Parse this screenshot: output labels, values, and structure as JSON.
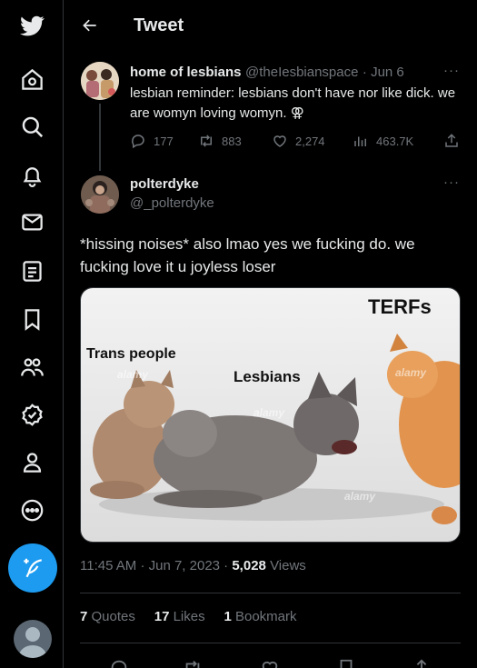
{
  "header": {
    "title": "Tweet"
  },
  "original_tweet": {
    "display_name": "home of lesbians",
    "handle": "@theIesbianspace",
    "date": "· Jun 6",
    "text": "lesbian reminder: lesbians don't have nor like dick. we are womyn loving womyn. ⚢",
    "replies": "177",
    "retweets": "883",
    "likes": "2,274",
    "views": "463.7K",
    "more": "···"
  },
  "reply_tweet": {
    "display_name": "polterdyke",
    "handle": "@_polterdyke",
    "more": "···",
    "text": "*hissing noises* also lmao yes we fucking do. we fucking love it u joyless loser",
    "image": {
      "labels": {
        "left": "Trans people",
        "middle": "Lesbians",
        "right": "TERFs"
      },
      "watermark": "alamy"
    },
    "time": "11:45 AM",
    "date": "· Jun 7, 2023 ·",
    "views_count": "5,028",
    "views_label": "Views",
    "quotes_count": "7",
    "quotes_label": "Quotes",
    "likes_count": "17",
    "likes_label": "Likes",
    "bookmarks_count": "1",
    "bookmarks_label": "Bookmark"
  },
  "colors": {
    "accent": "#1d9bf0",
    "muted": "#71767b",
    "text": "#e7e9ea",
    "border": "#2f3336"
  },
  "sidebar_icons": [
    "twitter-bird-icon",
    "home-icon",
    "search-icon",
    "bell-icon",
    "mail-icon",
    "lists-icon",
    "bookmarks-icon",
    "communities-icon",
    "verified-icon",
    "profile-icon",
    "more-icon",
    "compose-icon"
  ]
}
